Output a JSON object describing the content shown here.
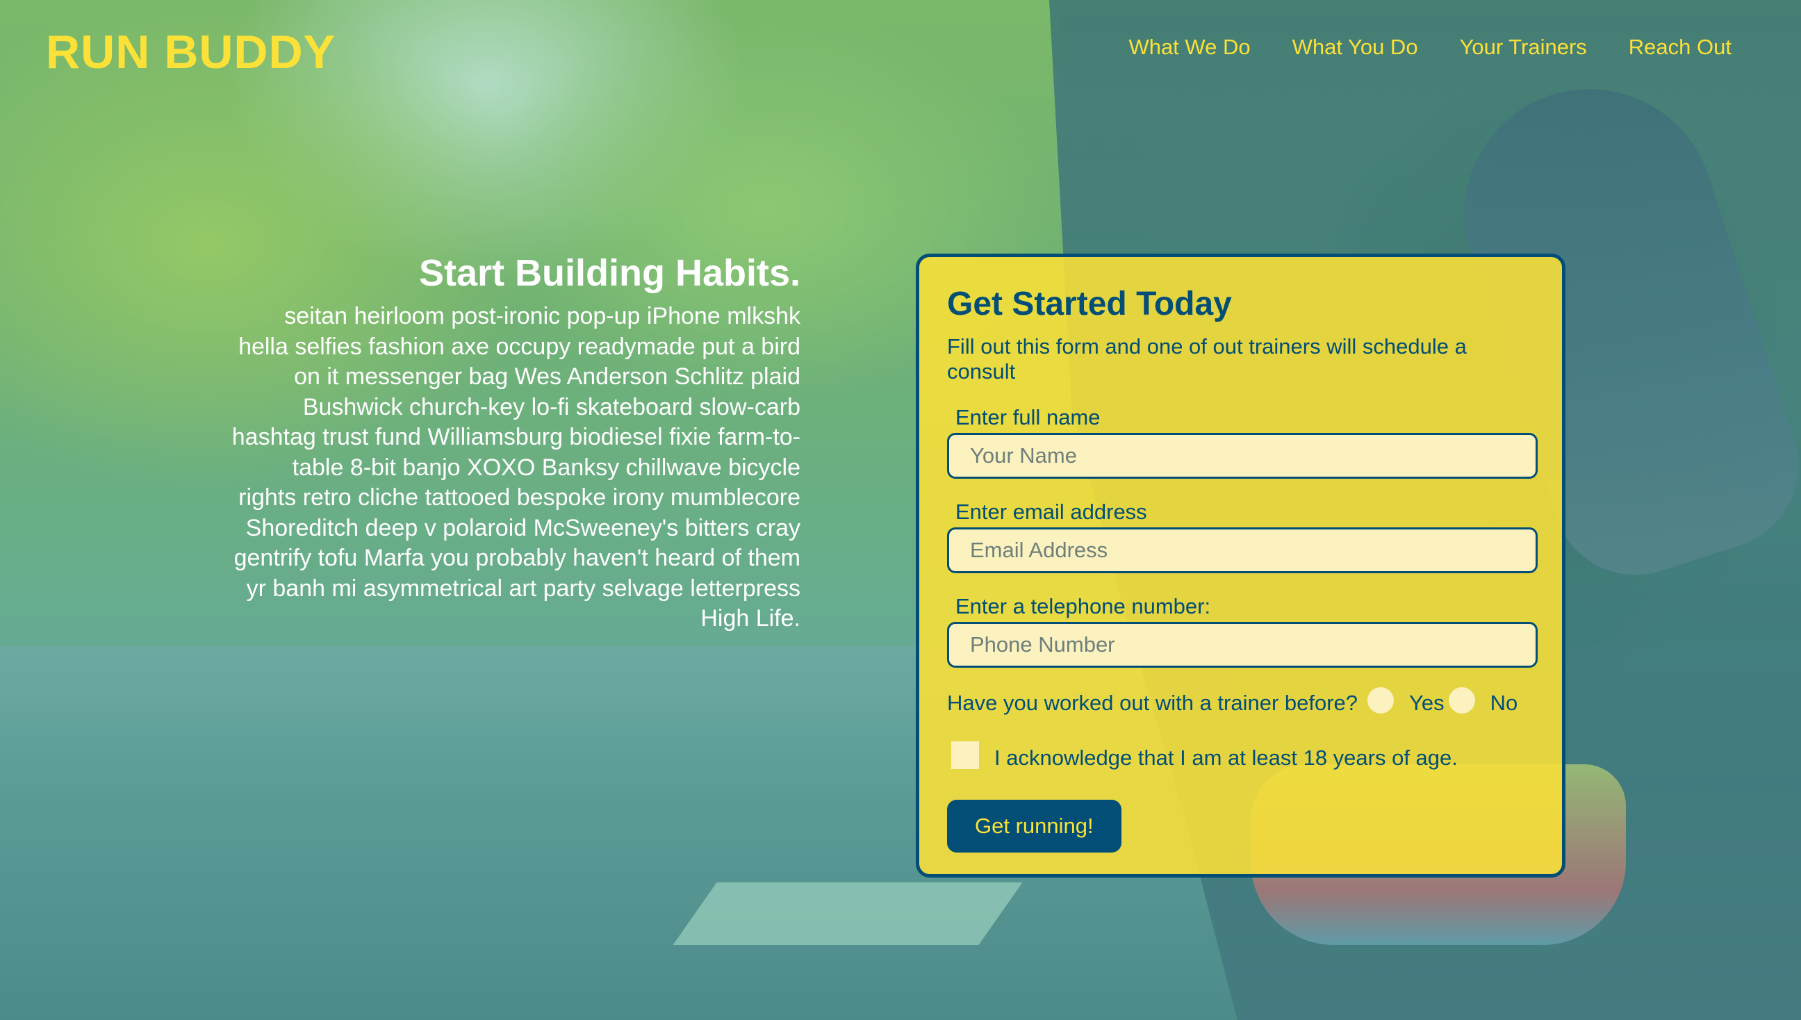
{
  "header": {
    "logo": "RUN BUDDY",
    "nav": [
      {
        "label": "What We Do"
      },
      {
        "label": "What You Do"
      },
      {
        "label": "Your Trainers"
      },
      {
        "label": "Reach Out"
      }
    ]
  },
  "hero": {
    "title": "Start Building Habits.",
    "body": "seitan heirloom post-ironic pop-up iPhone mlkshk hella selfies fashion axe occupy readymade put a bird on it messenger bag Wes Anderson Schlitz plaid Bushwick church-key lo-fi skateboard slow-carb hashtag trust fund Williamsburg biodiesel fixie farm-to-table 8-bit banjo XOXO Banksy chillwave bicycle rights retro cliche tattooed bespoke irony mumblecore Shoreditch deep v polaroid McSweeney's bitters cray gentrify tofu Marfa you probably haven't heard of them yr banh mi asymmetrical art party selvage letterpress High Life."
  },
  "form": {
    "title": "Get Started Today",
    "subtitle": "Fill out this form and one of out trainers will schedule a consult",
    "name": {
      "label": "Enter full name",
      "placeholder": "Your Name",
      "value": ""
    },
    "email": {
      "label": "Enter email address",
      "placeholder": "Email Address",
      "value": ""
    },
    "phone": {
      "label": "Enter a telephone number:",
      "placeholder": "Phone Number",
      "value": ""
    },
    "trainer_question": "Have you worked out with a trainer before?",
    "trainer_options": [
      {
        "label": "Yes"
      },
      {
        "label": "No"
      }
    ],
    "age_ack": "I acknowledge that I am at least 18 years of age.",
    "submit_label": "Get running!"
  },
  "colors": {
    "accent_yellow": "#fce138",
    "primary_blue": "#024e76",
    "input_bg": "#fbf2c0"
  }
}
